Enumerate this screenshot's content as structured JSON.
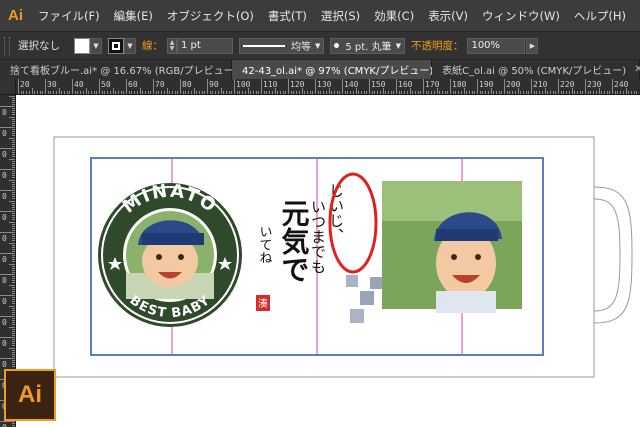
{
  "app": {
    "logo_text": "Ai"
  },
  "menu": [
    "ファイル(F)",
    "編集(E)",
    "オブジェクト(O)",
    "書式(T)",
    "選択(S)",
    "効果(C)",
    "表示(V)",
    "ウィンドウ(W)",
    "ヘルプ(H)"
  ],
  "control": {
    "selection": "選択なし",
    "stroke_label": "線：",
    "stroke_weight": "1 pt",
    "profile": "均等",
    "brush": "5 pt. 丸筆",
    "opacity_label": "不透明度：",
    "opacity": "100%"
  },
  "tabs": [
    {
      "label": "捨て看板ブルー.ai* @ 16.67% (RGB/プレビュー)",
      "active": false
    },
    {
      "label": "42-43_ol.ai* @ 97% (CMYK/プレビュー)",
      "active": true
    },
    {
      "label": "表紙C_ol.ai @ 50% (CMYK/プレビュー)",
      "active": false
    }
  ],
  "ruler": {
    "top": [
      "20",
      "30",
      "40",
      "50",
      "60",
      "70",
      "80",
      "90",
      "100",
      "110",
      "120",
      "130",
      "140",
      "150",
      "160",
      "170",
      "180",
      "190",
      "200",
      "210",
      "220",
      "230",
      "240"
    ],
    "left": [
      "0",
      "0",
      "0",
      "0",
      "0",
      "0",
      "0",
      "0",
      "0",
      "0",
      "0",
      "0",
      "0",
      "0",
      "0",
      "0",
      "0"
    ]
  },
  "artwork": {
    "badge_top": "MINATO",
    "badge_bottom": "BEST BABY",
    "calligraphy_col1": "じいじ、",
    "calligraphy_col2": "いつまでも",
    "calligraphy_main": "元気で",
    "calligraphy_col4": "いてね",
    "seal": "湊"
  },
  "badge_logo": "Ai",
  "colors": {
    "accent": "#f29a1f",
    "badge_green": "#2f4a2b",
    "guide_blue": "#5a7fc0",
    "guide_magenta": "#e040a0",
    "circle_red": "#e02020"
  }
}
